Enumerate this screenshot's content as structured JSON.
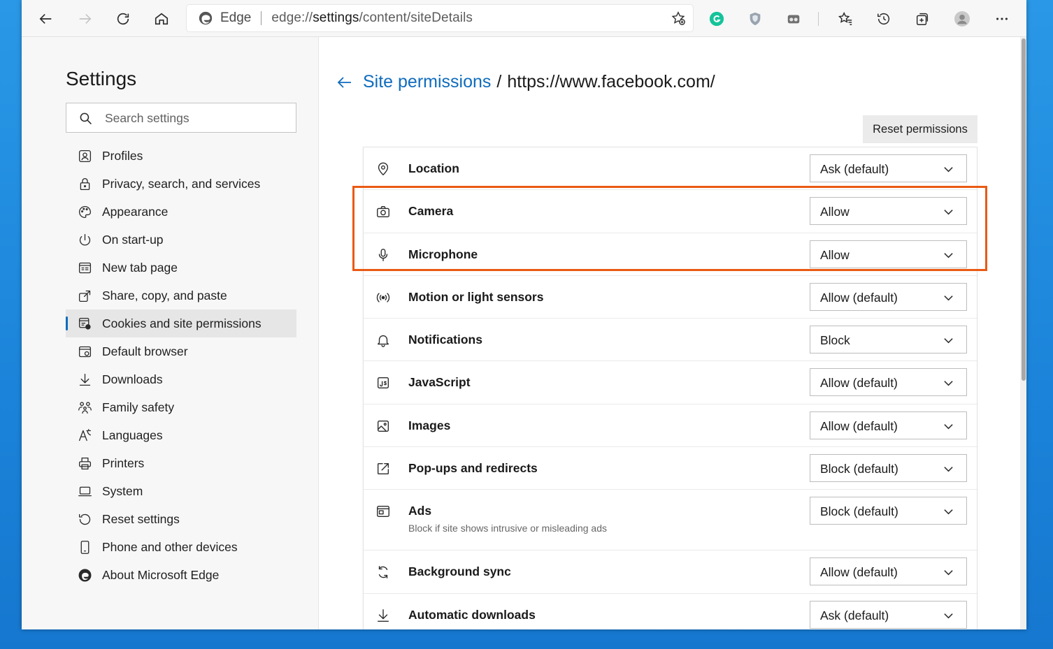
{
  "toolbar": {
    "address": {
      "brand": "Edge",
      "url_prefix": "edge://",
      "url_host": "settings",
      "url_path": "/content/siteDetails"
    }
  },
  "sidebar": {
    "title": "Settings",
    "search_placeholder": "Search settings",
    "items": [
      {
        "label": "Profiles",
        "icon": "profile-icon"
      },
      {
        "label": "Privacy, search, and services",
        "icon": "lock-icon"
      },
      {
        "label": "Appearance",
        "icon": "palette-icon"
      },
      {
        "label": "On start-up",
        "icon": "power-icon"
      },
      {
        "label": "New tab page",
        "icon": "newtab-icon"
      },
      {
        "label": "Share, copy, and paste",
        "icon": "share-icon"
      },
      {
        "label": "Cookies and site permissions",
        "icon": "cookies-icon",
        "active": true
      },
      {
        "label": "Default browser",
        "icon": "browser-icon"
      },
      {
        "label": "Downloads",
        "icon": "download-icon"
      },
      {
        "label": "Family safety",
        "icon": "family-icon"
      },
      {
        "label": "Languages",
        "icon": "language-icon"
      },
      {
        "label": "Printers",
        "icon": "printer-icon"
      },
      {
        "label": "System",
        "icon": "laptop-icon"
      },
      {
        "label": "Reset settings",
        "icon": "reset-icon"
      },
      {
        "label": "Phone and other devices",
        "icon": "phone-icon"
      },
      {
        "label": "About Microsoft Edge",
        "icon": "edge-logo-icon"
      }
    ]
  },
  "main": {
    "breadcrumb_link": "Site permissions",
    "breadcrumb_sep": "/",
    "site": "https://www.facebook.com/",
    "reset_label": "Reset permissions",
    "permissions": [
      {
        "label": "Location",
        "value": "Ask (default)",
        "icon": "location-icon"
      },
      {
        "label": "Camera",
        "value": "Allow",
        "icon": "camera-icon"
      },
      {
        "label": "Microphone",
        "value": "Allow",
        "icon": "microphone-icon"
      },
      {
        "label": "Motion or light sensors",
        "value": "Allow (default)",
        "icon": "sensor-icon"
      },
      {
        "label": "Notifications",
        "value": "Block",
        "icon": "bell-icon"
      },
      {
        "label": "JavaScript",
        "value": "Allow (default)",
        "icon": "javascript-icon"
      },
      {
        "label": "Images",
        "value": "Allow (default)",
        "icon": "image-icon"
      },
      {
        "label": "Pop-ups and redirects",
        "value": "Block (default)",
        "icon": "popup-icon"
      },
      {
        "label": "Ads",
        "value": "Block (default)",
        "sub": "Block if site shows intrusive or misleading ads",
        "icon": "ads-icon"
      },
      {
        "label": "Background sync",
        "value": "Allow (default)",
        "icon": "sync-icon"
      },
      {
        "label": "Automatic downloads",
        "value": "Ask (default)",
        "icon": "auto-download-icon"
      }
    ]
  },
  "colors": {
    "accent": "#0f6cbd",
    "highlight": "#ea5a14",
    "desktop": "#1b84da"
  }
}
